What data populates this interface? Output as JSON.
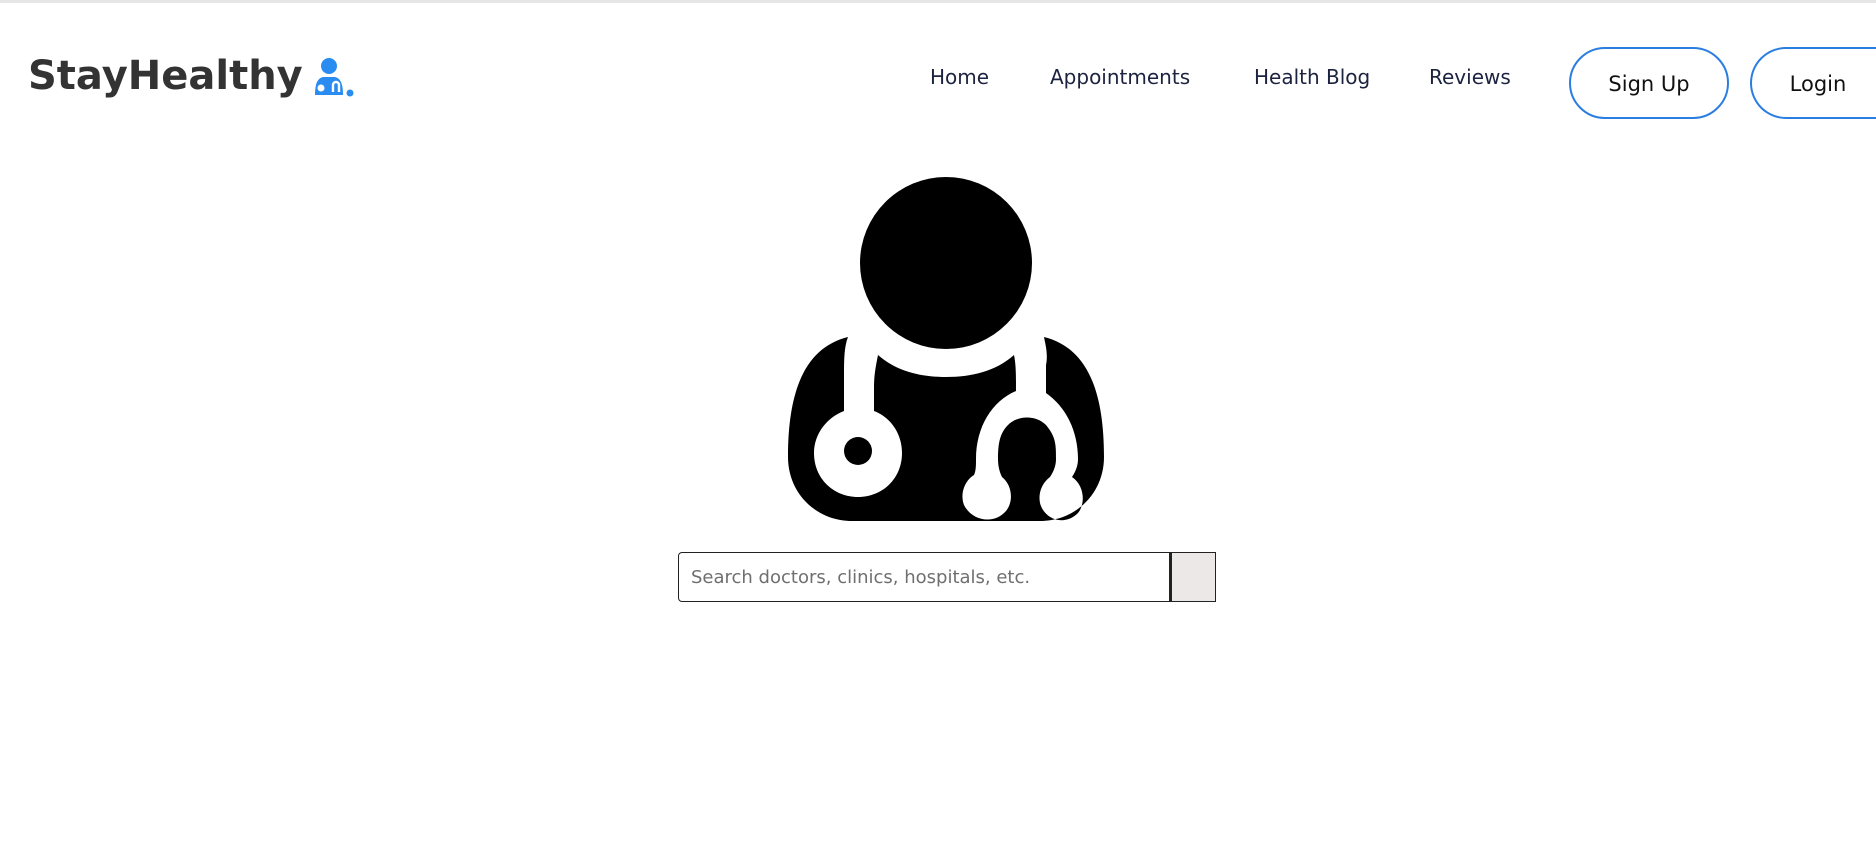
{
  "brand": {
    "name": "StayHealthy",
    "icon": "doctor-stethoscope-icon",
    "accent_color": "#2a8cf0"
  },
  "nav": {
    "links": [
      {
        "label": "Home"
      },
      {
        "label": "Appointments"
      },
      {
        "label": "Health Blog"
      },
      {
        "label": "Reviews"
      }
    ],
    "signup_label": "Sign Up",
    "login_label": "Login",
    "button_border_color": "#2a7de1"
  },
  "hero": {
    "icon": "doctor-stethoscope-icon"
  },
  "search": {
    "placeholder": "Search doctors, clinics, hospitals, etc.",
    "value": "",
    "button_icon": "search-button"
  }
}
